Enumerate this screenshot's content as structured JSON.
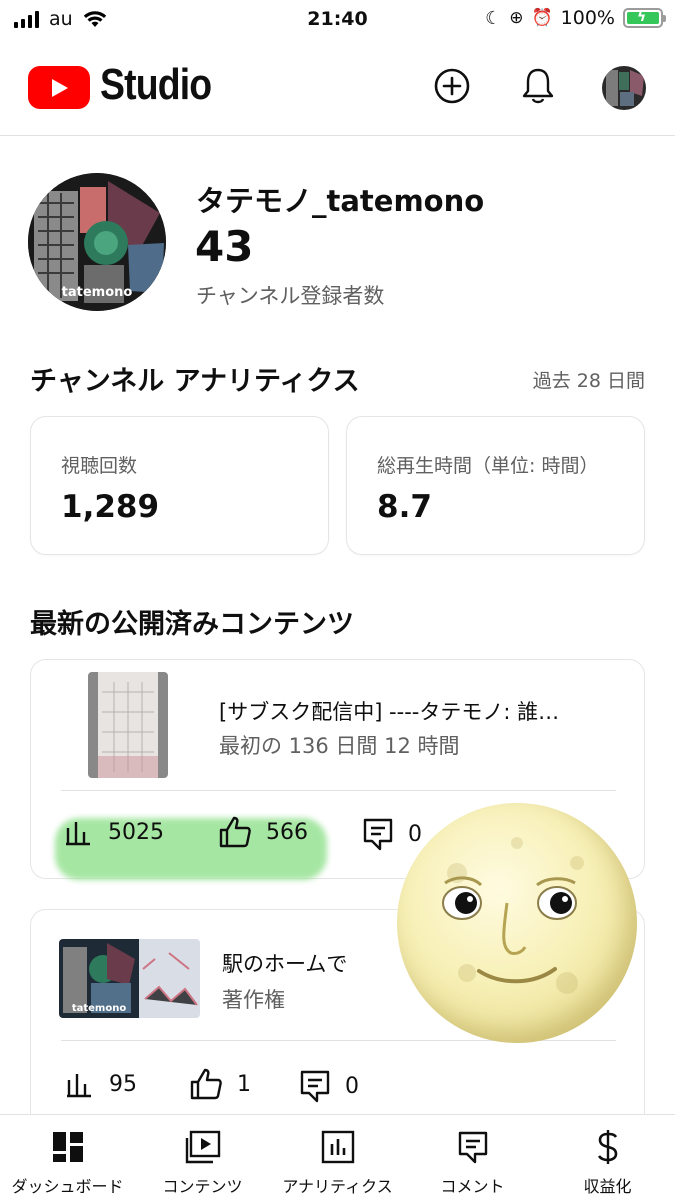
{
  "status_bar": {
    "carrier": "au",
    "time": "21:40",
    "battery": "100%"
  },
  "header": {
    "brand": "Studio"
  },
  "channel": {
    "name": "タテモノ_tatemono",
    "subscriber_count": "43",
    "subscriber_label": "チャンネル登録者数",
    "avatar_text": "tatemono"
  },
  "analytics": {
    "title": "チャンネル アナリティクス",
    "period": "過去 28 日間",
    "metrics": [
      {
        "label": "視聴回数",
        "value": "1,289"
      },
      {
        "label": "総再生時間（単位: 時間）",
        "value": "8.7"
      }
    ]
  },
  "latest": {
    "title": "最新の公開済みコンテンツ",
    "items": [
      {
        "title": "[サブスク配信中] ----タテモノ: 誰…",
        "subtitle": "最初の 136 日間 12 時間",
        "views": "5025",
        "likes": "566",
        "comments": "0"
      },
      {
        "title": "駅のホームで",
        "subtitle": "著作権",
        "thumb_text": "tatemono",
        "views": "95",
        "likes": "1",
        "comments": "0"
      }
    ]
  },
  "nav": [
    {
      "label": "ダッシュボード",
      "icon": "dashboard-icon"
    },
    {
      "label": "コンテンツ",
      "icon": "content-icon"
    },
    {
      "label": "アナリティクス",
      "icon": "analytics-icon"
    },
    {
      "label": "コメント",
      "icon": "comment-icon"
    },
    {
      "label": "収益化",
      "icon": "dollar-icon"
    }
  ],
  "colors": {
    "brand_red": "#ff0000",
    "battery_green": "#35c759",
    "highlight_green": "#8ee08a"
  }
}
